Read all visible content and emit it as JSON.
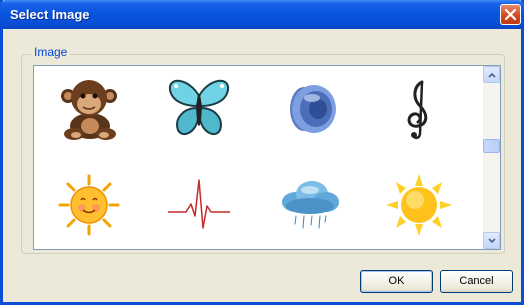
{
  "window": {
    "title": "Select Image"
  },
  "group": {
    "label": "Image"
  },
  "images": [
    {
      "icon": "monkey-icon"
    },
    {
      "icon": "butterfly-icon"
    },
    {
      "icon": "speaker-icon"
    },
    {
      "icon": "treble-clef-icon"
    },
    {
      "icon": "smiling-sun-icon"
    },
    {
      "icon": "heartbeat-icon"
    },
    {
      "icon": "rain-cloud-icon"
    },
    {
      "icon": "sun-icon"
    }
  ],
  "buttons": {
    "ok_label": "OK",
    "cancel_label": "Cancel"
  },
  "colors": {
    "titlebar": "#0a4fd6",
    "close": "#d24a22",
    "dialog_bg": "#ece9d8",
    "group_label": "#0046d5"
  }
}
